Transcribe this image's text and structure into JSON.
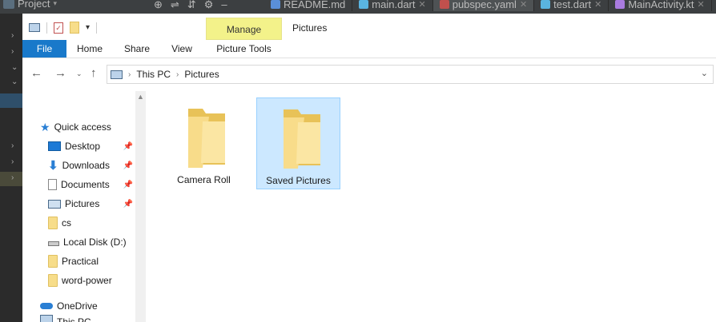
{
  "ide": {
    "project_label": "Project",
    "tabs": [
      {
        "label": "README.md",
        "color": "#5a8fd8"
      },
      {
        "label": "main.dart",
        "color": "#5ab4e0"
      },
      {
        "label": "pubspec.yaml",
        "color": "#c0504d"
      },
      {
        "label": "test.dart",
        "color": "#5ab4e0"
      },
      {
        "label": "MainActivity.kt",
        "color": "#a97bdf"
      }
    ]
  },
  "ribbon": {
    "manage_label": "Manage",
    "context_title": "Pictures",
    "tabs": [
      "File",
      "Home",
      "Share",
      "View",
      "Picture Tools"
    ]
  },
  "address": {
    "crumbs": [
      "This PC",
      "Pictures"
    ]
  },
  "nav": {
    "quick_access": "Quick access",
    "items": [
      {
        "label": "Desktop",
        "icon": "desktop-icon",
        "pinned": true
      },
      {
        "label": "Downloads",
        "icon": "download-icon",
        "pinned": true
      },
      {
        "label": "Documents",
        "icon": "documents-icon",
        "pinned": true
      },
      {
        "label": "Pictures",
        "icon": "pictures-icon",
        "pinned": true
      },
      {
        "label": "cs",
        "icon": "folder-icon",
        "pinned": false
      },
      {
        "label": "Local Disk (D:)",
        "icon": "disk-icon",
        "pinned": false
      },
      {
        "label": "Practical",
        "icon": "folder-icon",
        "pinned": false
      },
      {
        "label": "word-power",
        "icon": "folder-icon",
        "pinned": false
      }
    ],
    "onedrive": "OneDrive",
    "thispc": "This PC"
  },
  "files": [
    {
      "label": "Camera Roll",
      "selected": false
    },
    {
      "label": "Saved Pictures",
      "selected": true
    }
  ],
  "colors": {
    "accent": "#1979ca",
    "manage_bg": "#f3f28a",
    "selection": "#cce8ff"
  }
}
